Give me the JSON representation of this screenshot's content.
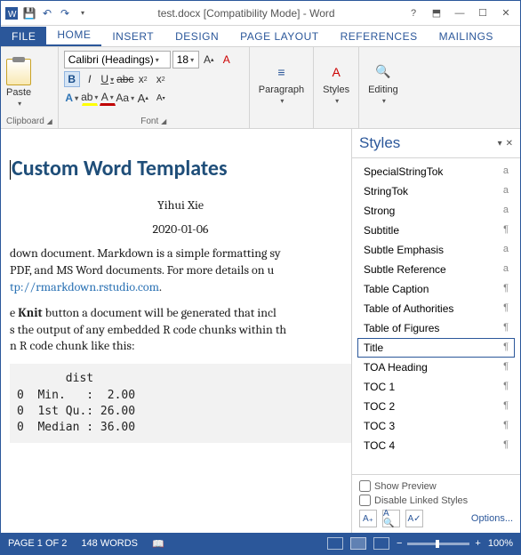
{
  "titlebar": {
    "title": "test.docx [Compatibility Mode] - Word"
  },
  "tabs": {
    "file": "FILE",
    "home": "HOME",
    "insert": "INSERT",
    "design": "DESIGN",
    "pagelayout": "PAGE LAYOUT",
    "references": "REFERENCES",
    "mailings": "MAILINGS"
  },
  "ribbon": {
    "paste": "Paste",
    "clipboard": "Clipboard",
    "font_name": "Calibri (Headings)",
    "font_size": "18",
    "font_label": "Font",
    "paragraph": "Paragraph",
    "styles": "Styles",
    "editing": "Editing"
  },
  "doc": {
    "title": "Custom Word Templates",
    "author": "Yihui Xie",
    "date": "2020-01-06",
    "p1a": "down document. Markdown is a simple formatting sy",
    "p1b": " PDF, and MS Word documents. For more details on u",
    "link": "tp://rmarkdown.rstudio.com",
    "p2a": "e ",
    "p2b": "Knit",
    "p2c": " button a document will be generated that incl",
    "p3": "s the output of any embedded R code chunks within th",
    "p4": "n R code chunk like this:",
    "code": "       dist\n0  Min.   :  2.00\n0  1st Qu.: 26.00\n0  Median : 36.00"
  },
  "styles_pane": {
    "title": "Styles",
    "items": [
      {
        "name": "SpecialStringTok",
        "mark": "a"
      },
      {
        "name": "StringTok",
        "mark": "a"
      },
      {
        "name": "Strong",
        "mark": "a"
      },
      {
        "name": "Subtitle",
        "mark": "¶"
      },
      {
        "name": "Subtle Emphasis",
        "mark": "a"
      },
      {
        "name": "Subtle Reference",
        "mark": "a"
      },
      {
        "name": "Table Caption",
        "mark": "¶"
      },
      {
        "name": "Table of Authorities",
        "mark": "¶"
      },
      {
        "name": "Table of Figures",
        "mark": "¶"
      },
      {
        "name": "Title",
        "mark": "¶",
        "selected": true
      },
      {
        "name": "TOA Heading",
        "mark": "¶"
      },
      {
        "name": "TOC 1",
        "mark": "¶"
      },
      {
        "name": "TOC 2",
        "mark": "¶"
      },
      {
        "name": "TOC 3",
        "mark": "¶"
      },
      {
        "name": "TOC 4",
        "mark": "¶"
      }
    ],
    "show_preview": "Show Preview",
    "disable_linked": "Disable Linked Styles",
    "options": "Options..."
  },
  "statusbar": {
    "page": "PAGE 1 OF 2",
    "words": "148 WORDS",
    "zoom": "100%"
  }
}
